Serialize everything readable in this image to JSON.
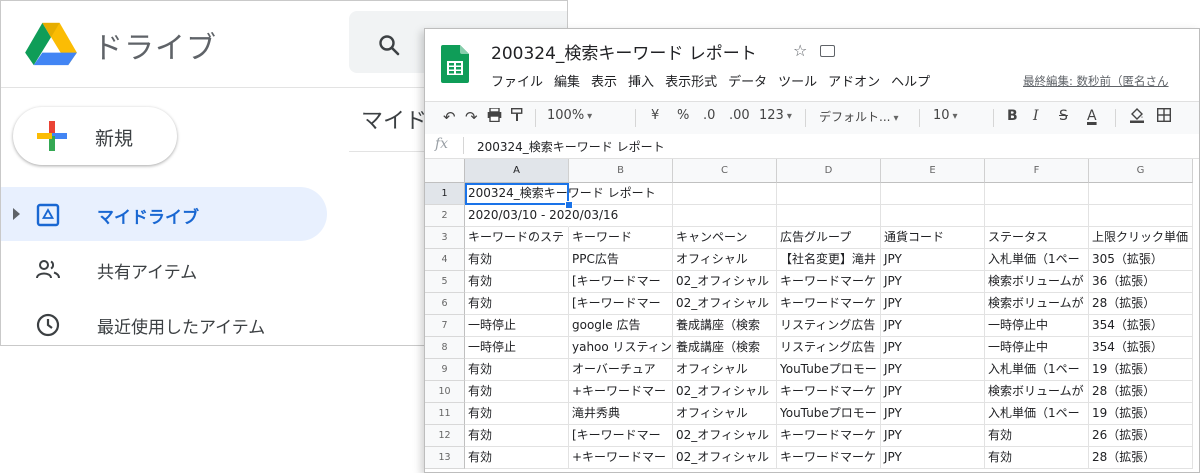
{
  "drive": {
    "brand": "ドライブ",
    "new_button": "新規",
    "nav": [
      {
        "label": "マイドライブ",
        "icon": "drive-folder-icon",
        "active": true
      },
      {
        "label": "共有アイテム",
        "icon": "people-icon",
        "active": false
      },
      {
        "label": "最近使用したアイテム",
        "icon": "clock-icon",
        "active": false
      }
    ],
    "main_title": "マイド"
  },
  "sheets": {
    "title": "200324_検索キーワード レポート",
    "menu": [
      "ファイル",
      "編集",
      "表示",
      "挿入",
      "表示形式",
      "データ",
      "ツール",
      "アドオン",
      "ヘルプ"
    ],
    "last_edit": "最終編集: 数秒前（匿名さん",
    "toolbar": {
      "zoom": "100%",
      "currency": "¥",
      "percent": "%",
      "dec_less": ".0",
      "dec_more": ".00",
      "format_more": "123",
      "font": "デフォルト...",
      "font_size": "10",
      "bold": "B",
      "italic": "I",
      "strike": "S",
      "text_color": "A"
    },
    "formula": "200324_検索キーワード レポート",
    "columns": [
      "A",
      "B",
      "C",
      "D",
      "E",
      "F",
      "G"
    ],
    "rows": [
      {
        "n": "1",
        "cells": [
          "200324_検索キーワード レポート",
          "",
          "",
          "",
          "",
          "",
          ""
        ]
      },
      {
        "n": "2",
        "cells": [
          "2020/03/10 - 2020/03/16",
          "",
          "",
          "",
          "",
          "",
          ""
        ]
      },
      {
        "n": "3",
        "cells": [
          "キーワードのステ",
          "キーワード",
          "キャンペーン",
          "広告グループ",
          "通貨コード",
          "ステータス",
          "上限クリック単価"
        ]
      },
      {
        "n": "4",
        "cells": [
          "有効",
          "PPC広告",
          "オフィシャル",
          "【社名変更】滝井",
          "JPY",
          "入札単価（1ペー",
          "305（拡張）"
        ]
      },
      {
        "n": "5",
        "cells": [
          "有効",
          "[キーワードマー",
          "02_オフィシャル",
          "キーワードマーケ",
          "JPY",
          "検索ボリュームが",
          "36（拡張）"
        ]
      },
      {
        "n": "6",
        "cells": [
          "有効",
          "[キーワードマー",
          "02_オフィシャル",
          "キーワードマーケ",
          "JPY",
          "検索ボリュームが",
          "28（拡張）"
        ]
      },
      {
        "n": "7",
        "cells": [
          "一時停止",
          "google 広告",
          "養成講座（検索",
          "リスティング広告",
          "JPY",
          "一時停止中",
          "354（拡張）"
        ]
      },
      {
        "n": "8",
        "cells": [
          "一時停止",
          "yahoo リスティン",
          "養成講座（検索",
          "リスティング広告",
          "JPY",
          "一時停止中",
          "354（拡張）"
        ]
      },
      {
        "n": "9",
        "cells": [
          "有効",
          "オーバーチュア",
          "オフィシャル",
          "YouTubeプロモー",
          "JPY",
          "入札単価（1ペー",
          "19（拡張）"
        ]
      },
      {
        "n": "10",
        "cells": [
          "有効",
          "+キーワードマー",
          "02_オフィシャル",
          "キーワードマーケ",
          "JPY",
          "検索ボリュームが",
          "28（拡張）"
        ]
      },
      {
        "n": "11",
        "cells": [
          "有効",
          "滝井秀典",
          "オフィシャル",
          "YouTubeプロモー",
          "JPY",
          "入札単価（1ペー",
          "19（拡張）"
        ]
      },
      {
        "n": "12",
        "cells": [
          "有効",
          "[キーワードマー",
          "02_オフィシャル",
          "キーワードマーケ",
          "JPY",
          "有効",
          "26（拡張）"
        ]
      },
      {
        "n": "13",
        "cells": [
          "有効",
          "+キーワードマー",
          "02_オフィシャル",
          "キーワードマーケ",
          "JPY",
          "有効",
          "28（拡張）"
        ]
      }
    ]
  },
  "colors": {
    "drive_active_bg": "#e8f0fe",
    "drive_active_text": "#1967d2",
    "sheets_green": "#0f9d58",
    "selection_blue": "#1a73e8"
  }
}
